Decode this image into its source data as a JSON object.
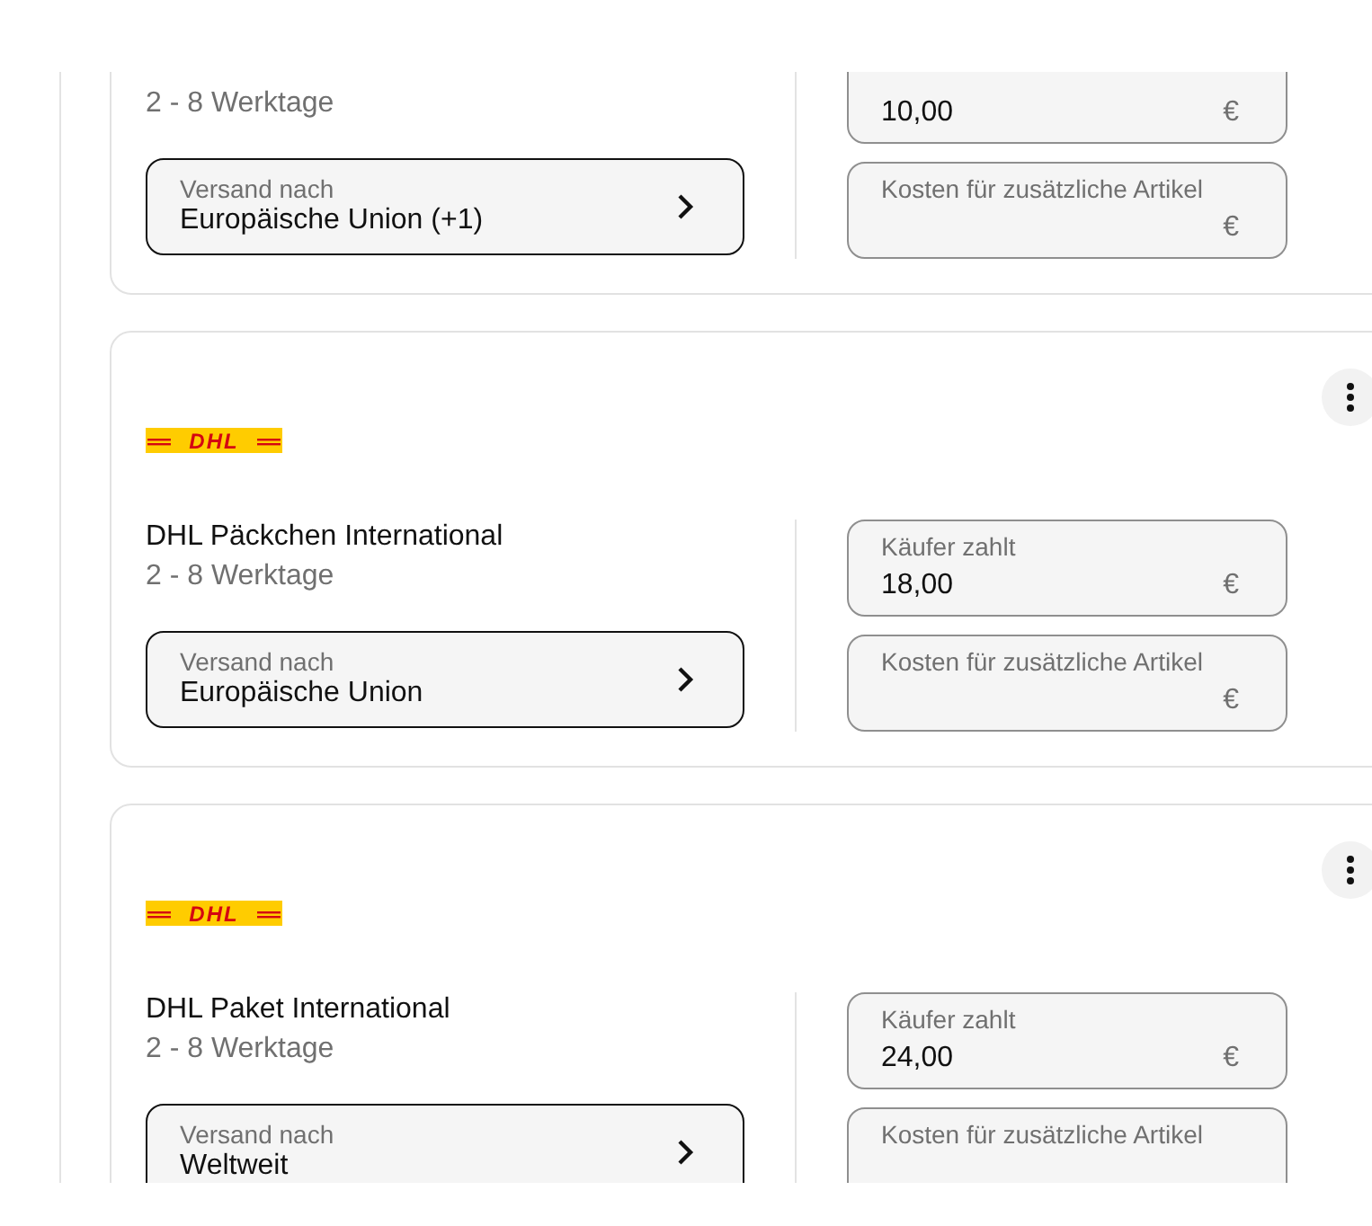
{
  "shipping_options": [
    {
      "menu": false,
      "delivery_time": "2 - 8 Werktage",
      "destination": {
        "label": "Versand nach",
        "value": "Europäische Union (+1)"
      },
      "fields": [
        {
          "value": "10,00",
          "currency": "€"
        },
        {
          "label": "Kosten für zusätzliche Artikel",
          "currency": "€"
        }
      ]
    },
    {
      "menu": true,
      "logo": "DHL",
      "service": "DHL Päckchen International",
      "delivery_time": "2 - 8 Werktage",
      "destination": {
        "label": "Versand nach",
        "value": "Europäische Union"
      },
      "fields": [
        {
          "label": "Käufer zahlt",
          "value": "18,00",
          "currency": "€"
        },
        {
          "label": "Kosten für zusätzliche Artikel",
          "currency": "€"
        }
      ]
    },
    {
      "menu": true,
      "logo": "DHL",
      "service": "DHL Paket International",
      "delivery_time": "2 - 8 Werktage",
      "destination": {
        "label": "Versand nach",
        "value": "Weltweit"
      },
      "fields": [
        {
          "label": "Käufer zahlt",
          "value": "24,00",
          "currency": "€"
        },
        {
          "label": "Kosten für zusätzliche Artikel"
        }
      ]
    }
  ]
}
